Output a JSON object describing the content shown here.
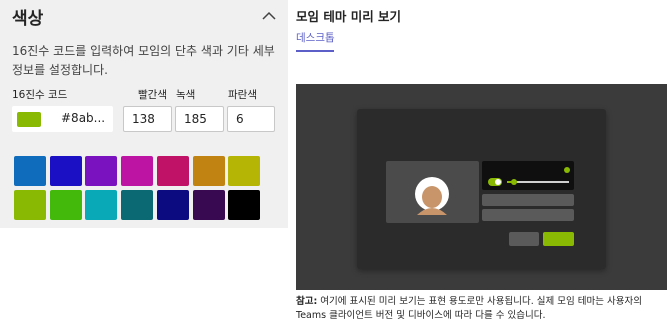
{
  "left_panel": {
    "title": "색상",
    "description": "16진수 코드를 입력하여 모임의 단추 색과 기타 세부 정보를 설정합니다.",
    "hex_label": "16진수 코드",
    "hex_value": "#8ab...",
    "selected_color": "#8ab904",
    "red_label": "빨간색",
    "green_label": "녹색",
    "blue_label": "파란색",
    "red_value": "138",
    "green_value": "185",
    "blue_value": "6",
    "swatches": [
      "#0f6cbd",
      "#1b10c4",
      "#7a12c0",
      "#be14a4",
      "#c01266",
      "#c18412",
      "#b5b506",
      "#8ab904",
      "#43b90b",
      "#0aa9b7",
      "#0a6973",
      "#0c0c80",
      "#380950",
      "#000000"
    ]
  },
  "preview": {
    "title": "모임 테마 미리 보기",
    "tab_desktop": "데스크톱",
    "note_bold": "참고:",
    "note_text": " 여기에 표시된 미리 보기는 표현 용도로만 사용됩니다. 실제 모임 테마는 사용자의 Teams 클라이언트 버전 및 디바이스에 따라 다를 수 있습니다."
  },
  "colors": {
    "accent": "#8ab904",
    "tab_accent": "#5b5fc7"
  }
}
